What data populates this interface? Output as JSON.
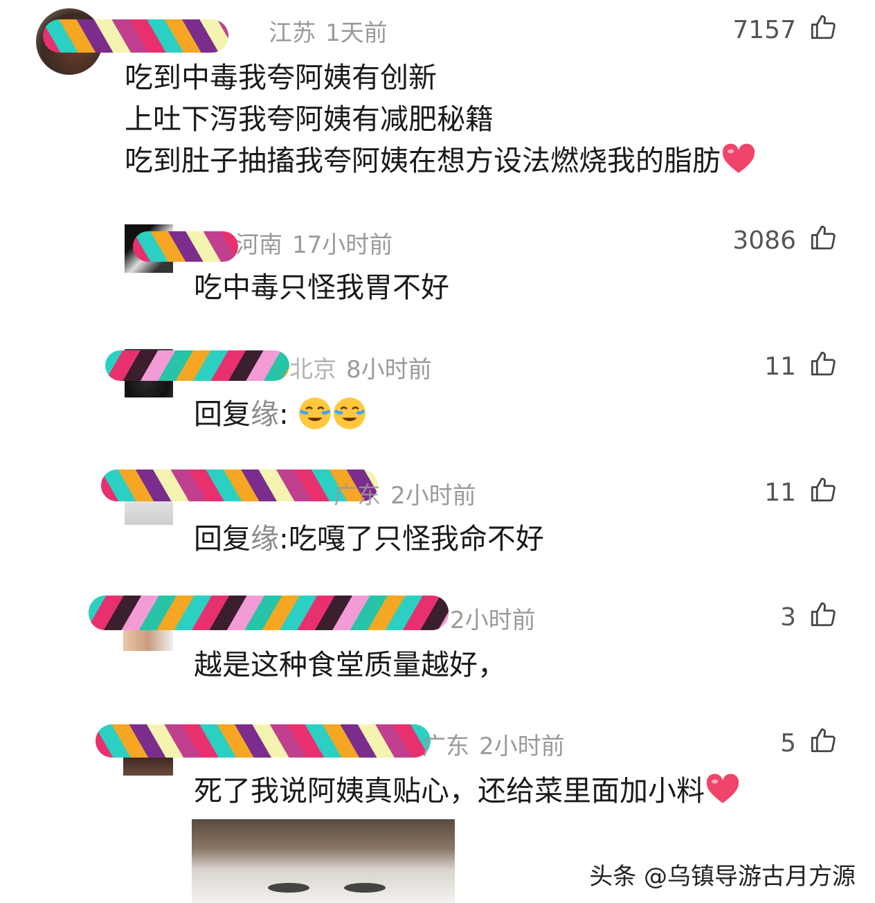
{
  "comments": [
    {
      "region": "江苏",
      "time": "1天前",
      "likes": "7157",
      "lines": [
        "吃到中毒我夸阿姨有创新",
        "上吐下泻我夸阿姨有减肥秘籍",
        "吃到肚子抽搐我夸阿姨在想方设法燃烧我的脂肪"
      ]
    },
    {
      "region": "河南",
      "time": "17小时前",
      "likes": "3086",
      "text": "吃中毒只怪我胃不好"
    },
    {
      "region": "北京",
      "time": "8小时前",
      "likes": "11",
      "reply_prefix": "回复",
      "reply_to": "缘",
      "text": ":"
    },
    {
      "region": "广东",
      "time": "2小时前",
      "likes": "11",
      "reply_prefix": "回复",
      "reply_to": "缘",
      "text": ":吃嘎了只怪我命不好"
    },
    {
      "region": "",
      "time": "2小时前",
      "likes": "3",
      "text": "越是这种食堂质量越好，"
    },
    {
      "region": "广东",
      "time": "2小时前",
      "likes": "5",
      "text": "死了我说阿姨真贴心，还给菜里面加小料"
    }
  ],
  "icons": {
    "like": "thumbs-up-icon",
    "heart": "red-heart-emoji",
    "crying": "loudly-crying-emoji"
  },
  "watermark": "头条 @乌镇导游古月方源"
}
